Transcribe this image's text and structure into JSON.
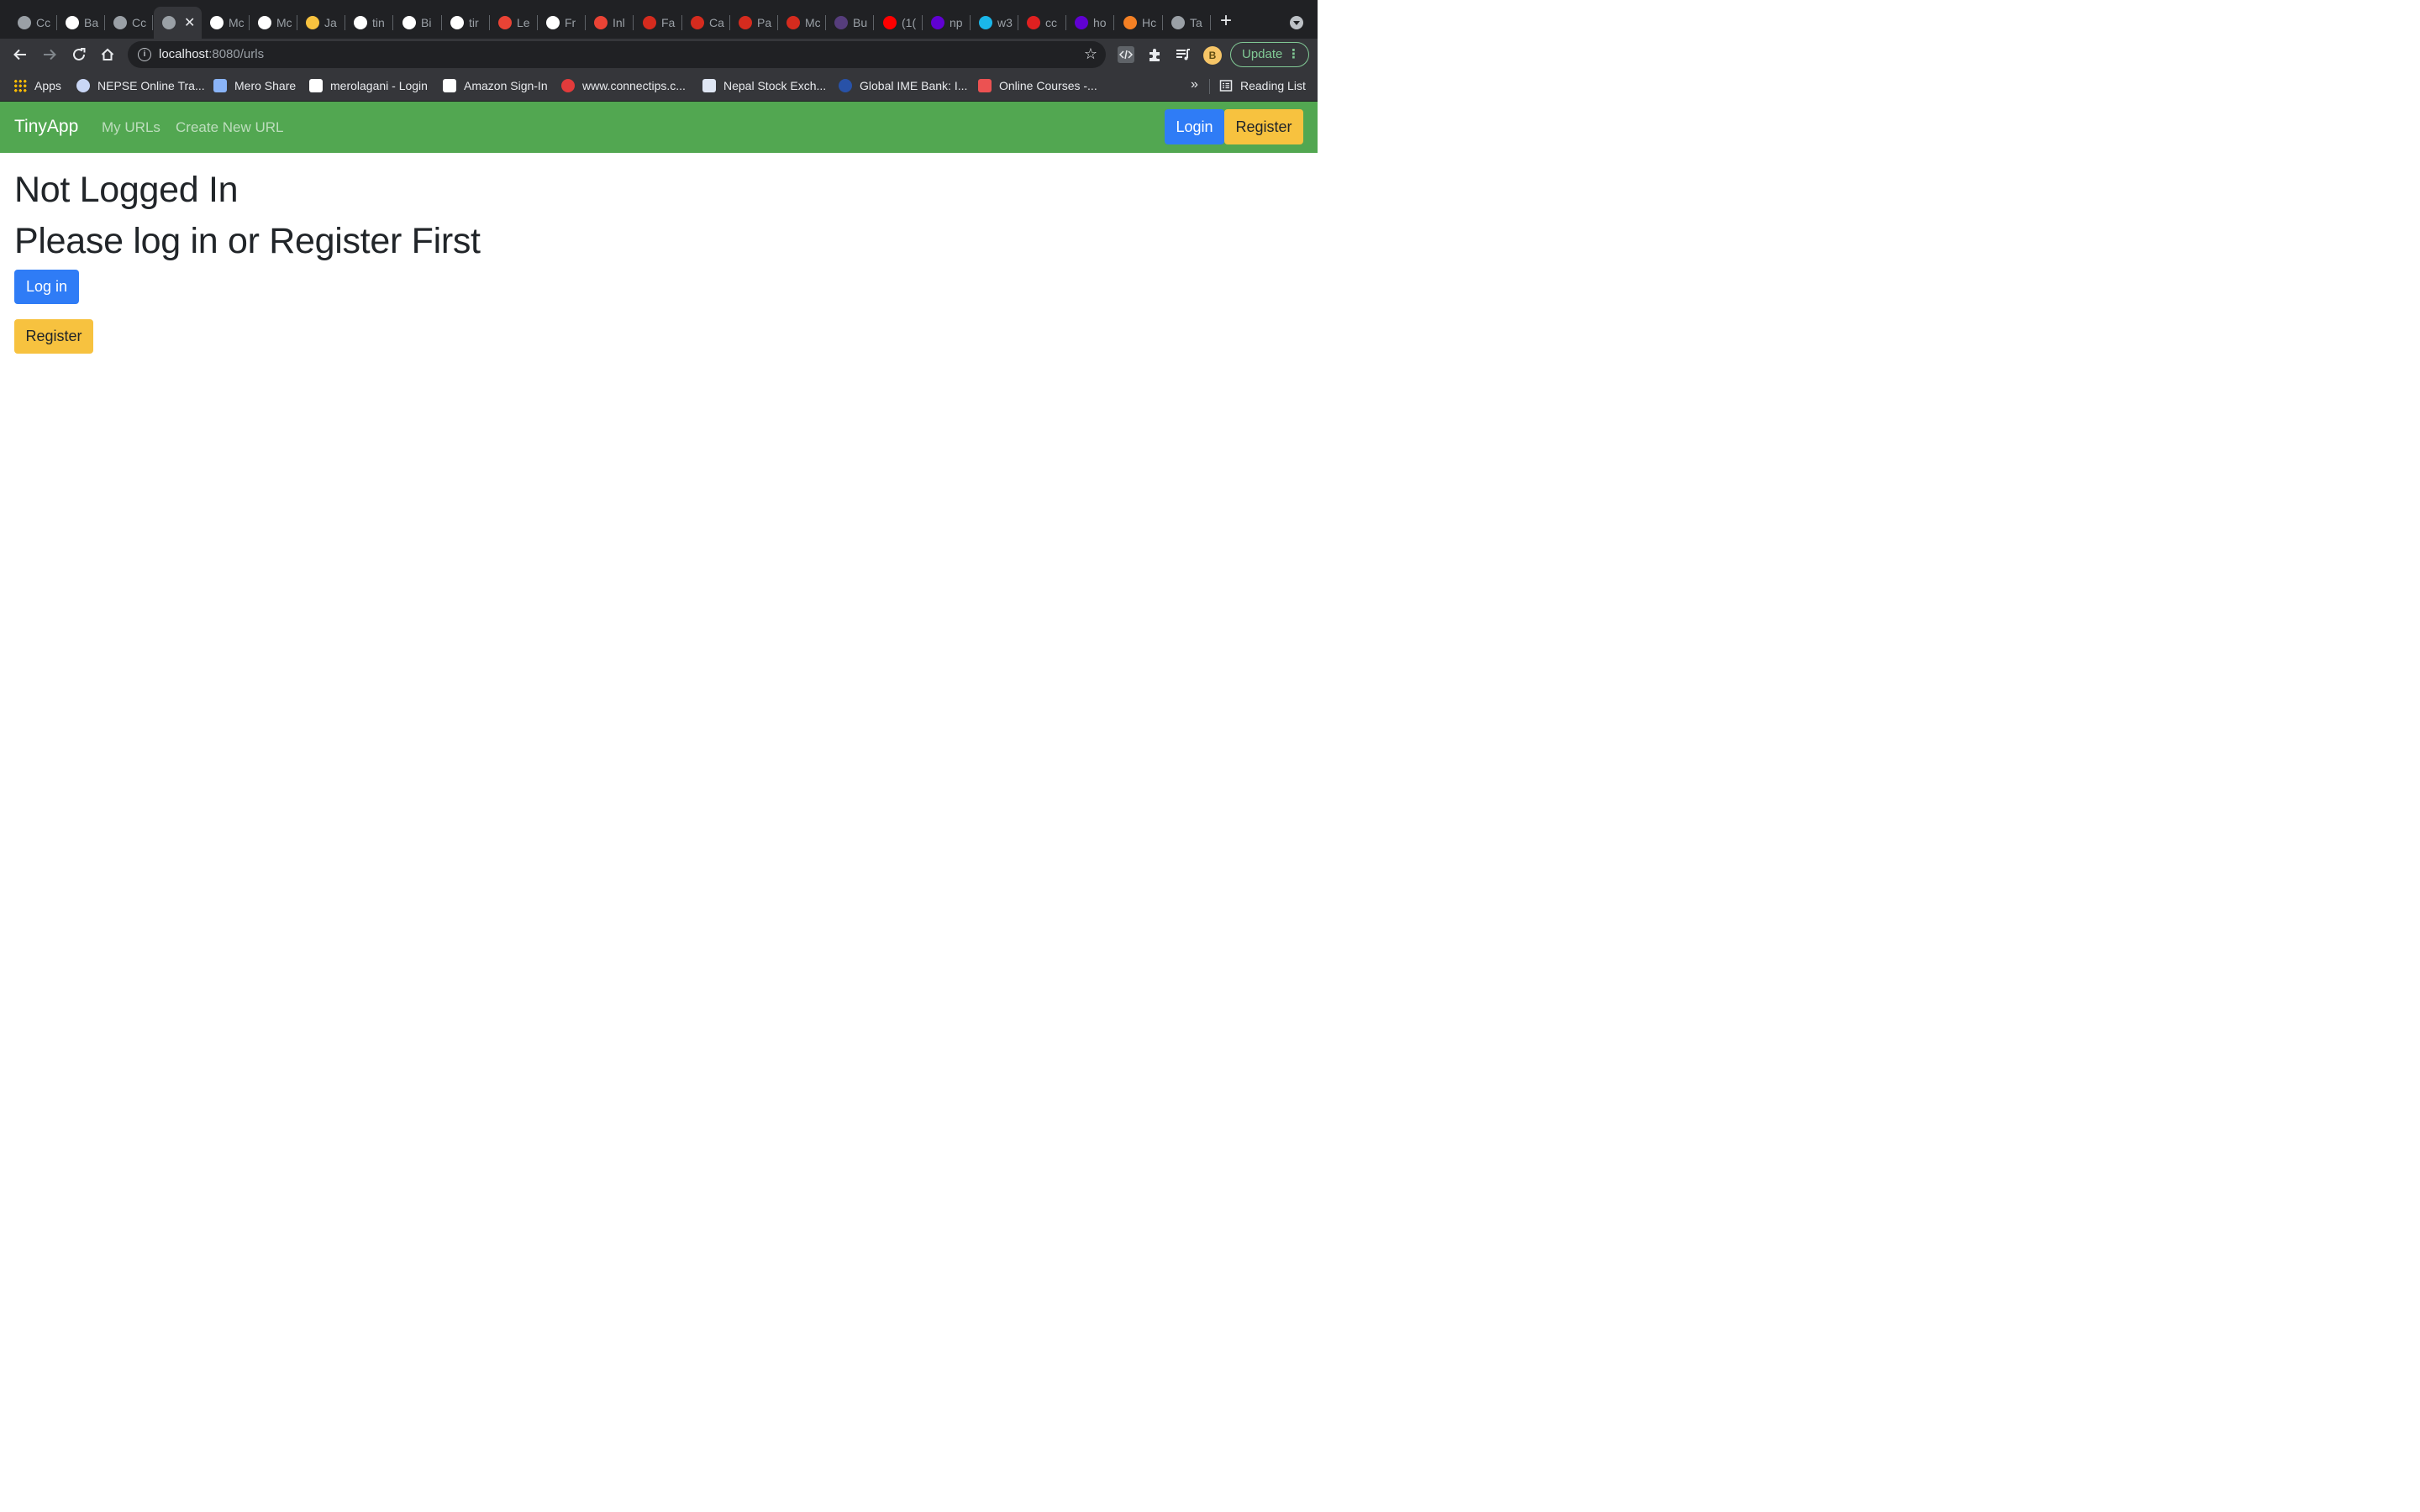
{
  "browser": {
    "tabs": [
      {
        "title": "Cc",
        "icon": "github-globe-icon",
        "color": "#9aa0a6"
      },
      {
        "title": "Ba",
        "icon": "github-icon",
        "color": "#ffffff"
      },
      {
        "title": "Cc",
        "icon": "globe-icon",
        "color": "#9aa0a6"
      },
      {
        "title": "",
        "icon": "globe-icon",
        "color": "#9aa0a6",
        "active": true
      },
      {
        "title": "Mc",
        "icon": "spiral-icon",
        "color": "#ffffff"
      },
      {
        "title": "Mc",
        "icon": "spiral-icon",
        "color": "#ffffff"
      },
      {
        "title": "Ja",
        "icon": "python-icon",
        "color": "#f7c23f"
      },
      {
        "title": "tin",
        "icon": "github-icon",
        "color": "#ffffff"
      },
      {
        "title": "Bi",
        "icon": "github-icon",
        "color": "#ffffff"
      },
      {
        "title": "tir",
        "icon": "github-icon",
        "color": "#ffffff"
      },
      {
        "title": "Le",
        "icon": "gmail-icon",
        "color": "#ea4335"
      },
      {
        "title": "Fr",
        "icon": "github-icon",
        "color": "#ffffff"
      },
      {
        "title": "Inl",
        "icon": "gmail-icon",
        "color": "#ea4335"
      },
      {
        "title": "Fa",
        "icon": "maple-leaf-icon",
        "color": "#d52b1e"
      },
      {
        "title": "Ca",
        "icon": "maple-leaf-icon",
        "color": "#d52b1e"
      },
      {
        "title": "Pa",
        "icon": "maple-leaf-icon",
        "color": "#d52b1e"
      },
      {
        "title": "Mc",
        "icon": "maple-leaf-icon",
        "color": "#d52b1e"
      },
      {
        "title": "Bu",
        "icon": "bootstrap-icon",
        "color": "#563d7c"
      },
      {
        "title": "(1(",
        "icon": "youtube-icon",
        "color": "#ff0000"
      },
      {
        "title": "np",
        "icon": "yahoo-icon",
        "color": "#6001d2"
      },
      {
        "title": "w3",
        "icon": "vimeo-icon",
        "color": "#1ab7ea"
      },
      {
        "title": "cc",
        "icon": "napkin-icon",
        "color": "#e02020"
      },
      {
        "title": "ho",
        "icon": "yahoo-icon",
        "color": "#6001d2"
      },
      {
        "title": "Hc",
        "icon": "stackoverflow-icon",
        "color": "#f48024"
      },
      {
        "title": "Ta",
        "icon": "apple-icon",
        "color": "#9aa0a6"
      }
    ],
    "close_glyph": "✕",
    "new_tab_glyph": "+",
    "url_host": "localhost",
    "url_rest": ":8080/urls",
    "profile_initial": "B",
    "update_label": "Update",
    "bookmarks": [
      {
        "label": "Apps",
        "icon": "apps-grid-icon",
        "color": "#4285f4"
      },
      {
        "label": "NEPSE Online Tra...",
        "icon": "nepse-icon",
        "color": "#c9d6f5"
      },
      {
        "label": "Mero Share",
        "icon": "mero-share-icon",
        "color": "#8ab4f8"
      },
      {
        "label": "merolagani - Login",
        "icon": "merolagani-icon",
        "color": "#ffffff"
      },
      {
        "label": "Amazon Sign-In",
        "icon": "amazon-icon",
        "color": "#ffffff"
      },
      {
        "label": "www.connectips.c...",
        "icon": "connectips-icon",
        "color": "#e23b3b"
      },
      {
        "label": "Nepal Stock Exch...",
        "icon": "nepal-stock-icon",
        "color": "#dfe6f3"
      },
      {
        "label": "Global IME Bank: I...",
        "icon": "global-ime-icon",
        "color": "#2852a8"
      },
      {
        "label": "Online Courses -...",
        "icon": "udemy-icon",
        "color": "#ec5252"
      }
    ],
    "bookmarks_more": "»",
    "reading_list_label": "Reading List"
  },
  "app": {
    "brand": "TinyApp",
    "nav_links": [
      "My URLs",
      "Create New URL"
    ],
    "login_label": "Login",
    "register_label": "Register"
  },
  "main": {
    "heading": "Not Logged In",
    "subheading": "Please log in or Register First",
    "login_button": "Log in",
    "register_button": "Register"
  }
}
